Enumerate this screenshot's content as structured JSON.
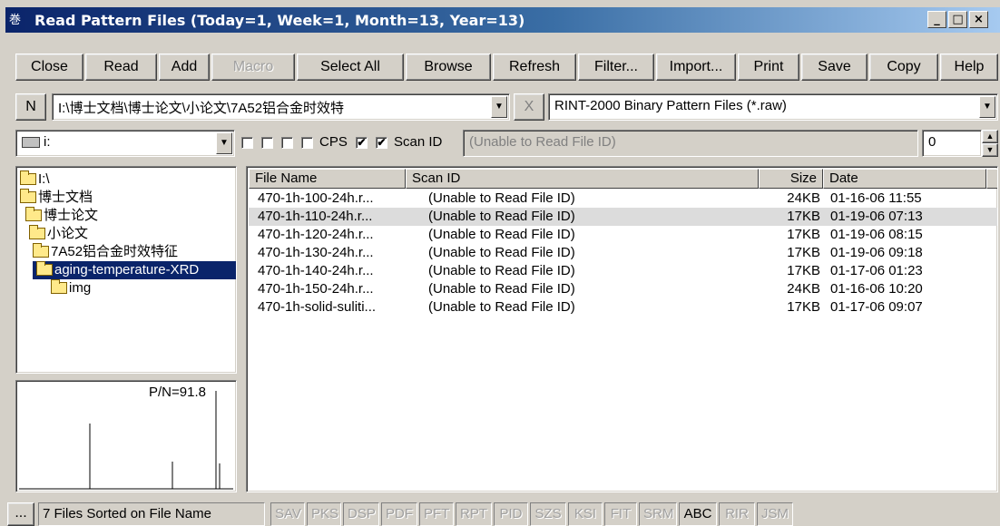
{
  "window": {
    "title": "Read Pattern Files (Today=1, Week=1, Month=13, Year=13)",
    "icon_glyph": "巻"
  },
  "toolbar": {
    "buttons": [
      {
        "label": "Close",
        "enabled": true
      },
      {
        "label": "Read",
        "enabled": true
      },
      {
        "label": "Add",
        "enabled": true
      },
      {
        "label": "Macro",
        "enabled": false
      },
      {
        "label": "Select All",
        "enabled": true
      },
      {
        "label": "Browse",
        "enabled": true
      },
      {
        "label": "Refresh",
        "enabled": true
      },
      {
        "label": "Filter...",
        "enabled": true
      },
      {
        "label": "Import...",
        "enabled": true
      },
      {
        "label": "Print",
        "enabled": true
      },
      {
        "label": "Save",
        "enabled": true
      },
      {
        "label": "Copy",
        "enabled": true
      },
      {
        "label": "Help",
        "enabled": true
      }
    ]
  },
  "pathbar": {
    "n_label": "N",
    "path": "I:\\博士文档\\博士论文\\小论文\\7A52铝合金时效特",
    "clear_label": "X",
    "filter": "RINT-2000 Binary Pattern Files (*.raw)"
  },
  "optionsbar": {
    "drive": "i:",
    "cps_label": "CPS",
    "scanid_label": "Scan ID",
    "scanid_field": "(Unable to Read File ID)",
    "spinner_value": "0",
    "checks": [
      "",
      "",
      "",
      "",
      "✔",
      "✔"
    ]
  },
  "tree": [
    {
      "label": "I:\\",
      "selected": false
    },
    {
      "label": "博士文档",
      "selected": false
    },
    {
      "label": "博士论文",
      "selected": false
    },
    {
      "label": "小论文",
      "selected": false
    },
    {
      "label": "7A52铝合金时效特征",
      "selected": false
    },
    {
      "label": "aging-temperature-XRD",
      "selected": true
    },
    {
      "label": "img",
      "selected": false
    }
  ],
  "preview": {
    "pn_label": "P/N=91.8"
  },
  "filelist": {
    "headers": [
      "File Name",
      "Scan ID",
      "Size",
      "Date"
    ],
    "rows": [
      {
        "name": "470-1h-100-24h.r...",
        "scan": "(Unable to Read File ID)",
        "size": "24KB",
        "date": "01-16-06 11:55",
        "selected": false
      },
      {
        "name": "470-1h-110-24h.r...",
        "scan": "(Unable to Read File ID)",
        "size": "17KB",
        "date": "01-19-06 07:13",
        "selected": true
      },
      {
        "name": "470-1h-120-24h.r...",
        "scan": "(Unable to Read File ID)",
        "size": "17KB",
        "date": "01-19-06 08:15",
        "selected": false
      },
      {
        "name": "470-1h-130-24h.r...",
        "scan": "(Unable to Read File ID)",
        "size": "17KB",
        "date": "01-19-06 09:18",
        "selected": false
      },
      {
        "name": "470-1h-140-24h.r...",
        "scan": "(Unable to Read File ID)",
        "size": "17KB",
        "date": "01-17-06 01:23",
        "selected": false
      },
      {
        "name": "470-1h-150-24h.r...",
        "scan": "(Unable to Read File ID)",
        "size": "24KB",
        "date": "01-16-06 10:20",
        "selected": false
      },
      {
        "name": "470-1h-solid-suliti...",
        "scan": "(Unable to Read File ID)",
        "size": "17KB",
        "date": "01-17-06 09:07",
        "selected": false
      }
    ]
  },
  "statusbar": {
    "more_label": "...",
    "status_text": "7 Files Sorted on File Name",
    "tags": [
      {
        "label": "SAV",
        "enabled": false
      },
      {
        "label": "PKS",
        "enabled": false
      },
      {
        "label": "DSP",
        "enabled": false
      },
      {
        "label": "PDF",
        "enabled": false
      },
      {
        "label": "PFT",
        "enabled": false
      },
      {
        "label": "RPT",
        "enabled": false
      },
      {
        "label": "PID",
        "enabled": false
      },
      {
        "label": "SZS",
        "enabled": false
      },
      {
        "label": "KSI",
        "enabled": false
      },
      {
        "label": "FIT",
        "enabled": false
      },
      {
        "label": "SRM",
        "enabled": false
      },
      {
        "label": "ABC",
        "enabled": true
      },
      {
        "label": "RIR",
        "enabled": false
      },
      {
        "label": "JSM",
        "enabled": false
      }
    ]
  }
}
